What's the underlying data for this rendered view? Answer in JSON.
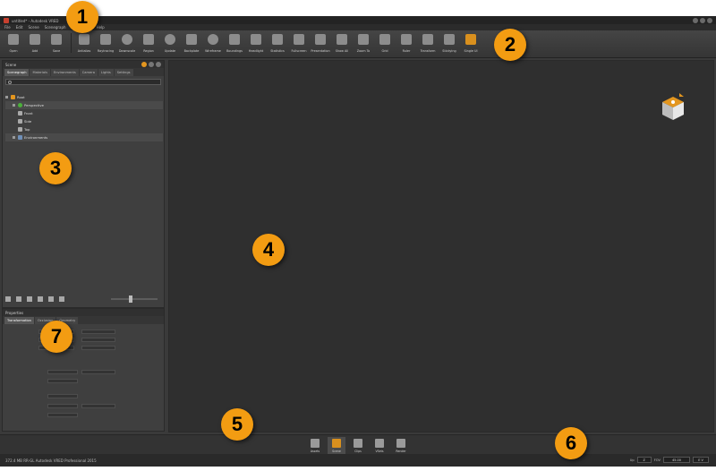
{
  "window": {
    "title": "untitled* - Autodesk VRED"
  },
  "menu": [
    "File",
    "Edit",
    "Scene",
    "Scenegraph",
    "Help"
  ],
  "toolbar": [
    {
      "label": "Open",
      "icon": "folder-icon"
    },
    {
      "label": "Add",
      "icon": "add-file-icon"
    },
    {
      "label": "Save",
      "icon": "save-icon"
    },
    {
      "label": "Antialias",
      "icon": "antialias-icon"
    },
    {
      "label": "Raytracing",
      "icon": "raytracing-icon"
    },
    {
      "label": "Downscale",
      "icon": "downscale-icon"
    },
    {
      "label": "Region",
      "icon": "region-icon"
    },
    {
      "label": "Update",
      "icon": "update-icon"
    },
    {
      "label": "Backplate",
      "icon": "backplate-icon"
    },
    {
      "label": "Wireframe",
      "icon": "wireframe-icon"
    },
    {
      "label": "Boundings",
      "icon": "boundings-icon"
    },
    {
      "label": "Headlight",
      "icon": "headlight-icon"
    },
    {
      "label": "Statistics",
      "icon": "statistics-icon"
    },
    {
      "label": "Fullscreen",
      "icon": "fullscreen-icon"
    },
    {
      "label": "Presentation",
      "icon": "presentation-icon"
    },
    {
      "label": "Show All",
      "icon": "show-all-icon"
    },
    {
      "label": "Zoom To",
      "icon": "zoom-to-icon"
    },
    {
      "label": "Grid",
      "icon": "grid-icon"
    },
    {
      "label": "Ruler",
      "icon": "ruler-icon"
    },
    {
      "label": "Transform",
      "icon": "transform-icon"
    },
    {
      "label": "Stickying",
      "icon": "stickying-icon"
    },
    {
      "label": "Single UI",
      "icon": "single-ui-icon"
    }
  ],
  "scene_panel": {
    "title": "Scene",
    "tabs": [
      "Scenegraph",
      "Materials",
      "Environments",
      "Camera",
      "Lights",
      "Settings"
    ],
    "tree": [
      {
        "label": "Root",
        "icon": "root-icon"
      },
      {
        "label": "Perspective",
        "icon": "perspective-camera-icon"
      },
      {
        "label": "Front",
        "icon": "front-camera-icon"
      },
      {
        "label": "Side",
        "icon": "side-camera-icon"
      },
      {
        "label": "Top",
        "icon": "top-camera-icon"
      },
      {
        "label": "Environments",
        "icon": "environments-icon"
      }
    ]
  },
  "properties_panel": {
    "title": "Properties",
    "tabs": [
      "Transformation",
      "Occlusion",
      "Geometry"
    ]
  },
  "dock": [
    {
      "label": "Assets",
      "icon": "assets-icon"
    },
    {
      "label": "Scene",
      "icon": "scene-icon"
    },
    {
      "label": "Clips",
      "icon": "clips-icon"
    },
    {
      "label": "VSets",
      "icon": "vsets-icon"
    },
    {
      "label": "Render",
      "icon": "render-icon"
    }
  ],
  "status": {
    "left": "372.4 MB  RR-GL  Autodesk VRED Professional 2015",
    "up_label": "Up",
    "up_value": "Z",
    "fov_label": "FOV",
    "fov_value": "45.00",
    "ncp_value": "E V"
  },
  "callouts": [
    "1",
    "2",
    "3",
    "4",
    "5",
    "6",
    "7"
  ],
  "colors": {
    "callout": "#f39c12",
    "accent": "#e3961f",
    "viewport": "#2f2f2f"
  }
}
